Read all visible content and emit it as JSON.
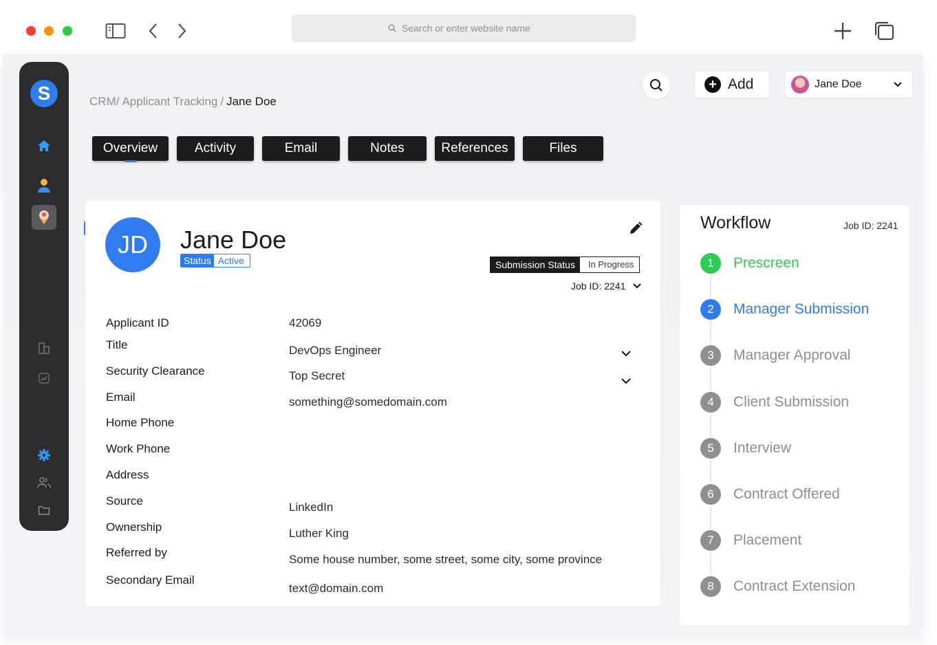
{
  "browser": {
    "url_placeholder": "Search or enter website name"
  },
  "header": {
    "add_label": "Add",
    "user_name": "Jane Doe"
  },
  "breadcrumb": {
    "part1": "CRM/",
    "part2": "Applicant Tracking",
    "sep": "/",
    "current": "Jane Doe"
  },
  "tabs": [
    {
      "label": "Overview"
    },
    {
      "label": "Activity"
    },
    {
      "label": "Email"
    },
    {
      "label": "Notes"
    },
    {
      "label": "References"
    },
    {
      "label": "Files"
    }
  ],
  "profile": {
    "initials": "JD",
    "name": "Jane Doe",
    "status_key": "Status",
    "status_value": "Active",
    "submission_status_key": "Submission Status",
    "submission_status_value": "In Progress",
    "job_id": "Job ID: 2241"
  },
  "fields": {
    "labels": [
      "Applicant ID",
      "Title",
      "Security Clearance",
      "Email",
      "Home Phone",
      "Work Phone",
      "Address",
      "Source",
      "Ownership",
      "Referred by",
      "Secondary Email"
    ],
    "values": [
      "42069",
      "DevOps Engineer",
      "Top Secret",
      "something@somedomain.com",
      "LinkedIn",
      "Luther King",
      "Some house number, some street, some city, some province",
      "text@domain.com"
    ]
  },
  "workflow": {
    "title": "Workflow",
    "job_id": "Job ID: 2241",
    "steps": [
      {
        "num": "1",
        "label": "Prescreen",
        "state": "done"
      },
      {
        "num": "2",
        "label": "Manager Submission",
        "state": "current"
      },
      {
        "num": "3",
        "label": "Manager Approval",
        "state": "pending"
      },
      {
        "num": "4",
        "label": "Client Submission",
        "state": "pending"
      },
      {
        "num": "5",
        "label": "Interview",
        "state": "pending"
      },
      {
        "num": "6",
        "label": "Contract Offered",
        "state": "pending"
      },
      {
        "num": "7",
        "label": "Placement",
        "state": "pending"
      },
      {
        "num": "8",
        "label": "Contract Extension",
        "state": "pending"
      }
    ]
  },
  "colors": {
    "accent": "#2f7bf0",
    "success": "#2ecc55",
    "sidebar": "#2c2c2e"
  }
}
